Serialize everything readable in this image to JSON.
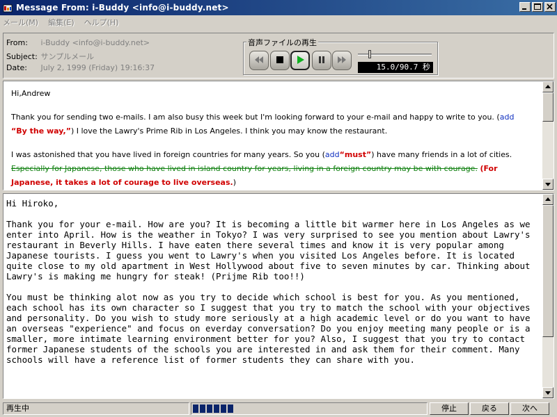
{
  "window": {
    "title": "Message From: i-Buddy <info@i-buddy.net>",
    "minimize": "_",
    "maximize": "□",
    "close": "×"
  },
  "menu": [
    "メール(M)",
    "編集(E)",
    "ヘルプ(H)"
  ],
  "header": {
    "from_label": "From:",
    "from_value": "i-Buddy <info@i-buddy.net>",
    "subject_label": "Subject:",
    "subject_value": "サンプルメール",
    "date_label": "Date:",
    "date_value": "July 2, 1999 (Friday) 19:16:37"
  },
  "player": {
    "group_label": "音声ファイルの再生",
    "time_display": "15.0/90.7 秒",
    "slider_position_fraction": 0.165,
    "buttons": [
      "rewind-icon",
      "stop-icon",
      "play-icon",
      "pause-icon",
      "fast-forward-icon"
    ]
  },
  "top_message": {
    "greeting": "Hi,Andrew",
    "p1_a": "Thank you for sending two e-mails. I am also busy this week but I'm looking forward to your e-mail and happy to write to you. (",
    "p1_add": "add",
    "p1_b": "“By the way,”",
    "p1_c": ") I love the Lawry's Prime Rib in Los Angeles. I think you may know the restaurant.",
    "p2_a": "I was astonished that you have lived in foreign countries for many years. So you (",
    "p2_add": "add",
    "p2_b": "“must”",
    "p2_c": ") have many friends in a lot of cities.",
    "p3_strike": "Especially for Japanese, those who have lived in island country for years, living in a foreign country may be with courage.",
    "p3_red1": "(For",
    "p4_red": "Japanese, it takes a lot of courage to live overseas.",
    "p4_end": ")"
  },
  "bottom_message": {
    "greeting": "Hi Hiroko,",
    "paragraph1": "Thank you for your e-mail. How are you? It is becoming a little bit warmer here in Los Angeles as we enter into April. How is the weather in Tokyo? I was very surprised to see you mention about Lawry's restaurant in Beverly Hills. I have eaten there several times and know it is very popular among Japanese tourists. I guess you went to Lawry's when you visited Los Angeles before. It is located quite close to my old apartment in West Hollywood about five to seven minutes by car. Thinking about Lawry's is making me hungry for steak! (Prijme Rib too!!)",
    "paragraph2": "You must be thinking alot now as you try to decide which school is best for you. As you mentioned, each school has its own character so I suggest that you try to match the school with your objectives and personality. Do you wish to study more seriously at a high academic level or do you want to have an overseas \"experience\" and focus on everday conversation? Do you enjoy meeting many people or is a smaller, more intimate learning environment better for you? Also, I suggest that you try to contact former Japanese students of the schools you are interested in and ask them for their comment. Many schools will have a reference list of former students they can share with you."
  },
  "status": {
    "state": "再生中",
    "progress_fraction": 0.165,
    "stop_button": "停止",
    "back_button": "戻る",
    "next_button": "次へ"
  },
  "colors": {
    "titlebar_start": "#0a246a",
    "titlebar_end": "#3a6ea5",
    "correction_add": "#1030c0",
    "correction_emphasis": "#d00000",
    "strikethrough": "#108010",
    "progress": "#0a246a"
  }
}
